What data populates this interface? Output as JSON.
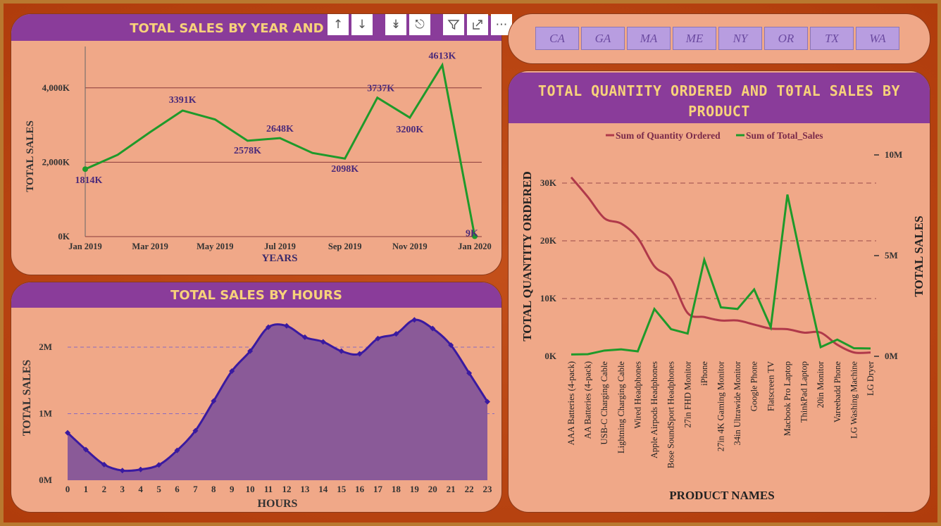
{
  "colors": {
    "panel_bg": "#f0a888",
    "title_bar": "#8a3c9a",
    "title_text": "#f7d27a",
    "line_green": "#1e9a2a",
    "line_red": "#b0394a",
    "area_fill": "#8a5a98",
    "area_line": "#3a1aa0"
  },
  "toolbar": {
    "icons": [
      "arrow-up-icon",
      "arrow-down-icon",
      "double-down-icon",
      "expand-hierarchy-icon",
      "filter-icon",
      "focus-mode-icon",
      "more-options-icon"
    ]
  },
  "states": [
    "CA",
    "GA",
    "MA",
    "ME",
    "NY",
    "OR",
    "TX",
    "WA"
  ],
  "chart_data": [
    {
      "type": "line",
      "title": "TOTAL SALES BY YEAR AND M",
      "xlabel": "YEARS",
      "ylabel": "TOTAL SALES",
      "ylim": [
        0,
        5000000
      ],
      "y_ticks": [
        "0K",
        "2,000K",
        "4,000K"
      ],
      "x_ticks": [
        "Jan 2019",
        "Mar 2019",
        "May 2019",
        "Jul 2019",
        "Sep 2019",
        "Nov 2019",
        "Jan 2020"
      ],
      "x": [
        "Jan 2019",
        "Feb 2019",
        "Mar 2019",
        "Apr 2019",
        "May 2019",
        "Jun 2019",
        "Jul 2019",
        "Aug 2019",
        "Sep 2019",
        "Oct 2019",
        "Nov 2019",
        "Dec 2019",
        "Jan 2020"
      ],
      "values": [
        1814000,
        2200000,
        2810000,
        3391000,
        3150000,
        2578000,
        2648000,
        2250000,
        2098000,
        3737000,
        3200000,
        4613000,
        9000
      ],
      "data_labels": [
        {
          "index": 0,
          "text": "1814K"
        },
        {
          "index": 3,
          "text": "3391K"
        },
        {
          "index": 5,
          "text": "2578K"
        },
        {
          "index": 6,
          "text": "2648K"
        },
        {
          "index": 8,
          "text": "2098K"
        },
        {
          "index": 9,
          "text": "3737K"
        },
        {
          "index": 10,
          "text": "3200K"
        },
        {
          "index": 11,
          "text": "4613K"
        },
        {
          "index": 12,
          "text": "9K"
        }
      ],
      "grid": true
    },
    {
      "type": "area",
      "title": "TOTAL SALES BY HOURS",
      "xlabel": "HOURS",
      "ylabel": "TOTAL SALES",
      "ylim": [
        0,
        2500000
      ],
      "y_ticks": [
        "0M",
        "1M",
        "2M"
      ],
      "x": [
        0,
        1,
        2,
        3,
        4,
        5,
        6,
        7,
        8,
        9,
        10,
        11,
        12,
        13,
        14,
        15,
        16,
        17,
        18,
        19,
        20,
        21,
        22,
        23
      ],
      "values": [
        713000,
        460000,
        235000,
        146000,
        162000,
        230000,
        448000,
        744000,
        1190000,
        1640000,
        1940000,
        2300000,
        2320000,
        2150000,
        2080000,
        1940000,
        1900000,
        2130000,
        2200000,
        2410000,
        2280000,
        2030000,
        1610000,
        1180000
      ],
      "grid": true
    },
    {
      "type": "line",
      "title": "TOTAL QUANTITY ORDERED AND T0TAL SALES BY PRODUCT",
      "xlabel": "PRODUCT NAMES",
      "ylabel": "TOTAL QUANTITY ORDERED",
      "ylabel_right": "TOTAL SALES",
      "legend_position": "top",
      "categories": [
        "AAA Batteries (4-pack)",
        "AA Batteries (4-pack)",
        "USB-C Charging Cable",
        "Lightning Charging Cable",
        "Wired Headphones",
        "Apple Airpods Headphones",
        "Bose SoundSport Headphones",
        "27in FHD Monitor",
        "iPhone",
        "27in 4K Gaming Monitor",
        "34in Ultrawide Monitor",
        "Google Phone",
        "Flatscreen TV",
        "Macbook Pro Laptop",
        "ThinkPad Laptop",
        "20in Monitor",
        "Vareebadd Phone",
        "LG Washing Machine",
        "LG Dryer"
      ],
      "y_ticks_left": [
        "0K",
        "10K",
        "20K",
        "30K"
      ],
      "y_ticks_right": [
        "0M",
        "5M",
        "10M"
      ],
      "ylim_left": [
        0,
        35000
      ],
      "ylim_right": [
        0,
        10000000
      ],
      "series": [
        {
          "name": "Sum of Quantity Ordered",
          "axis": "left",
          "values": [
            31000,
            27600,
            23900,
            23000,
            20500,
            15600,
            13400,
            7500,
            6800,
            6200,
            6200,
            5500,
            4800,
            4700,
            4100,
            4100,
            2000,
            670,
            650
          ]
        },
        {
          "name": "Sum of Total_Sales",
          "axis": "right",
          "values": [
            92000,
            106000,
            286000,
            347000,
            246000,
            2350000,
            1350000,
            1130000,
            4790000,
            2430000,
            2350000,
            3320000,
            1450000,
            8030000,
            4130000,
            454000,
            829000,
            400000,
            387000
          ]
        }
      ]
    }
  ]
}
